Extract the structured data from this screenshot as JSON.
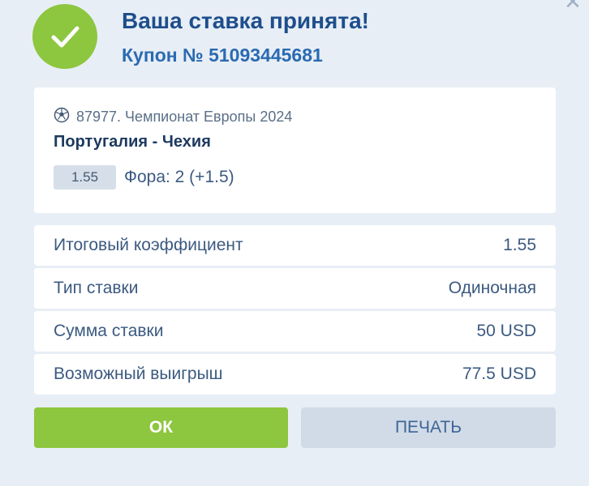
{
  "dialog": {
    "close_icon": "close-icon",
    "title": "Ваша ставка принята!",
    "coupon": "Купон № 51093445681"
  },
  "event": {
    "icon": "soccer-ball-icon",
    "league": "87977. Чемпионат Европы 2024",
    "teams": "Португалия - Чехия",
    "odds": "1.55",
    "bet": "Фора: 2 (+1.5)"
  },
  "summary": [
    {
      "label": "Итоговый коэффициент",
      "value": "1.55"
    },
    {
      "label": "Тип ставки",
      "value": "Одиночная"
    },
    {
      "label": "Сумма ставки",
      "value": "50 USD"
    },
    {
      "label": "Возможный выигрыш",
      "value": "77.5 USD"
    }
  ],
  "buttons": {
    "ok": "ОК",
    "print": "ПЕЧАТЬ"
  },
  "colors": {
    "accent_green": "#8dc63f",
    "title_blue": "#1e4e8c",
    "background": "#e8eef5"
  }
}
